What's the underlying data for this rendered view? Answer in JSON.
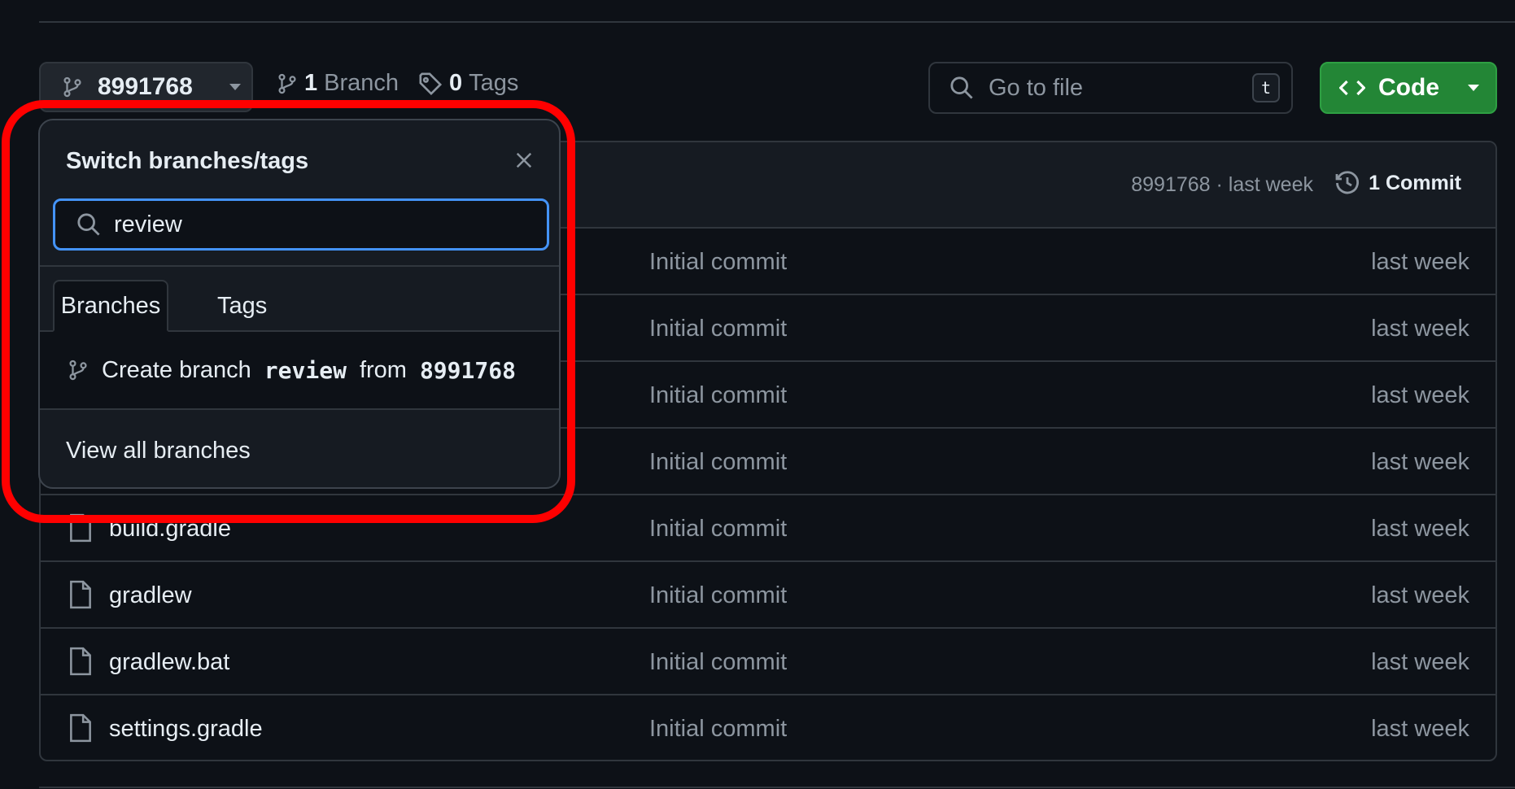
{
  "toolbar": {
    "branch_ref": "8991768",
    "branch_count": "1",
    "branch_label": "Branch",
    "tag_count": "0",
    "tag_label": "Tags",
    "goto_placeholder": "Go to file",
    "goto_shortcut": "t",
    "code_label": "Code"
  },
  "table": {
    "latest_commit_meta": "8991768 · last week",
    "commit_count_label": "1 Commit",
    "rows": [
      {
        "name": "",
        "message": "Initial commit",
        "date": "last week"
      },
      {
        "name": "",
        "message": "Initial commit",
        "date": "last week"
      },
      {
        "name": "",
        "message": "Initial commit",
        "date": "last week"
      },
      {
        "name": "",
        "message": "Initial commit",
        "date": "last week"
      },
      {
        "name": "build.gradle",
        "message": "Initial commit",
        "date": "last week"
      },
      {
        "name": "gradlew",
        "message": "Initial commit",
        "date": "last week"
      },
      {
        "name": "gradlew.bat",
        "message": "Initial commit",
        "date": "last week"
      },
      {
        "name": "settings.gradle",
        "message": "Initial commit",
        "date": "last week"
      }
    ]
  },
  "popover": {
    "title": "Switch branches/tags",
    "search_value": "review",
    "tabs": [
      "Branches",
      "Tags"
    ],
    "active_tab": "Branches",
    "create_prefix": "Create branch",
    "create_name": "review",
    "create_from_word": "from",
    "create_from_ref": "8991768",
    "view_all": "View all branches"
  },
  "colors": {
    "background": "#0d1117",
    "accent_green": "#238636",
    "focus_blue": "#4493f8",
    "highlight_red": "#ff0000"
  }
}
